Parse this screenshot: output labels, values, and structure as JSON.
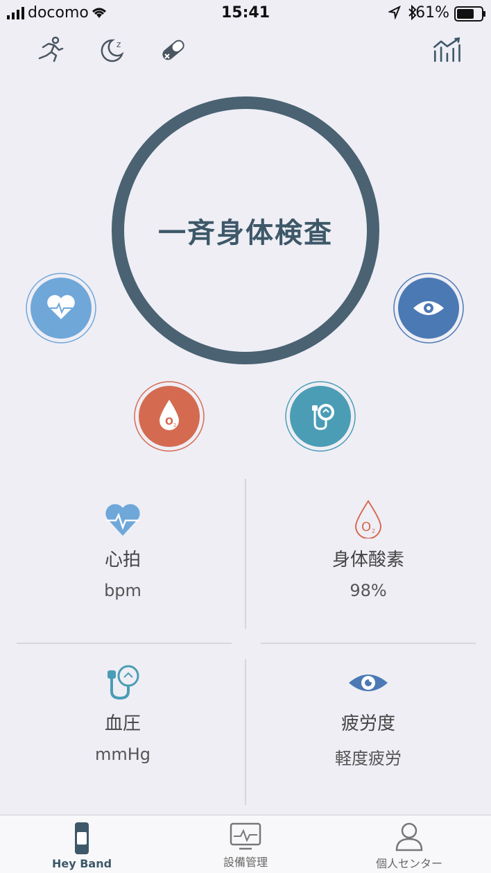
{
  "status_bar": {
    "carrier": "docomo",
    "time": "15:41",
    "battery": "61%"
  },
  "main": {
    "title": "一斉身体検査"
  },
  "metrics": {
    "heart_rate": {
      "label": "心拍",
      "value": "bpm"
    },
    "blood_oxygen": {
      "label": "身体酸素",
      "value": "98%"
    },
    "blood_pressure": {
      "label": "血圧",
      "value": "mmHg"
    },
    "fatigue": {
      "label": "疲労度",
      "value": "軽度疲労"
    }
  },
  "tabbar": {
    "tabs": [
      {
        "label": "Hey Band"
      },
      {
        "label": "設備管理"
      },
      {
        "label": "個人センター"
      }
    ]
  },
  "colors": {
    "ring": "#4a6272",
    "heart": "#6fa7d9",
    "eye": "#4b79b4",
    "oxygen": "#d46b50",
    "pressure": "#4a9db5",
    "background": "#efeef5"
  }
}
